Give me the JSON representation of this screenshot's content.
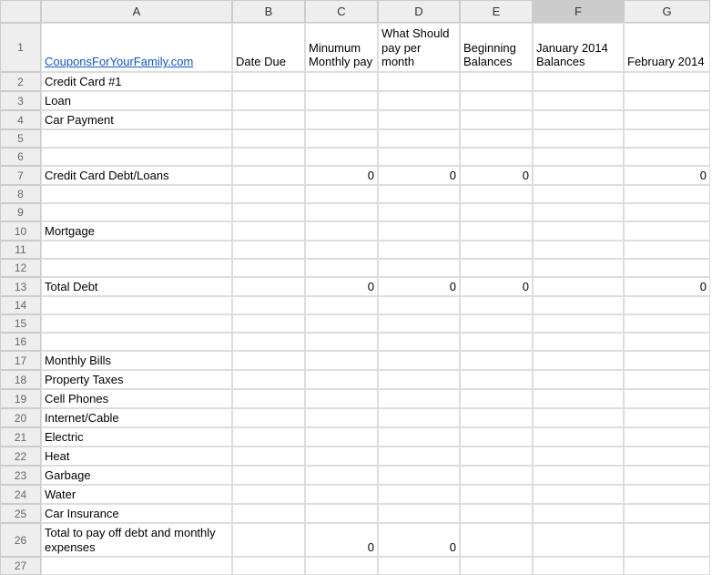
{
  "columns": [
    "A",
    "B",
    "C",
    "D",
    "E",
    "F",
    "G"
  ],
  "selectedCol": "F",
  "headerRow": {
    "A": {
      "text": "CouponsForYourFamily.com",
      "link": true
    },
    "B": "Date Due",
    "C": "Minumum Monthly pay",
    "D": "What Should pay per month",
    "E": "Beginning Balances",
    "F": "January 2014 Balances",
    "G": "February 2014"
  },
  "rows": [
    {
      "n": 2,
      "A": "Credit Card #1"
    },
    {
      "n": 3,
      "A": "Loan"
    },
    {
      "n": 4,
      "A": "Car Payment"
    },
    {
      "n": 5
    },
    {
      "n": 6
    },
    {
      "n": 7,
      "A": "Credit Card Debt/Loans",
      "C": "0",
      "D": "0",
      "E": "0",
      "G": "0"
    },
    {
      "n": 8
    },
    {
      "n": 9
    },
    {
      "n": 10,
      "A": "Mortgage"
    },
    {
      "n": 11
    },
    {
      "n": 12
    },
    {
      "n": 13,
      "A": "Total Debt",
      "C": "0",
      "D": "0",
      "E": "0",
      "G": "0"
    },
    {
      "n": 14
    },
    {
      "n": 15
    },
    {
      "n": 16
    },
    {
      "n": 17,
      "A": "Monthly Bills"
    },
    {
      "n": 18,
      "A": "Property Taxes"
    },
    {
      "n": 19,
      "A": "Cell Phones"
    },
    {
      "n": 20,
      "A": "Internet/Cable"
    },
    {
      "n": 21,
      "A": "Electric"
    },
    {
      "n": 22,
      "A": "Heat"
    },
    {
      "n": 23,
      "A": "Garbage"
    },
    {
      "n": 24,
      "A": "Water"
    },
    {
      "n": 25,
      "A": "Car Insurance"
    },
    {
      "n": 26,
      "A": "Total to pay off debt and monthly expenses",
      "C": "0",
      "D": "0",
      "tall": true
    },
    {
      "n": 27
    }
  ]
}
